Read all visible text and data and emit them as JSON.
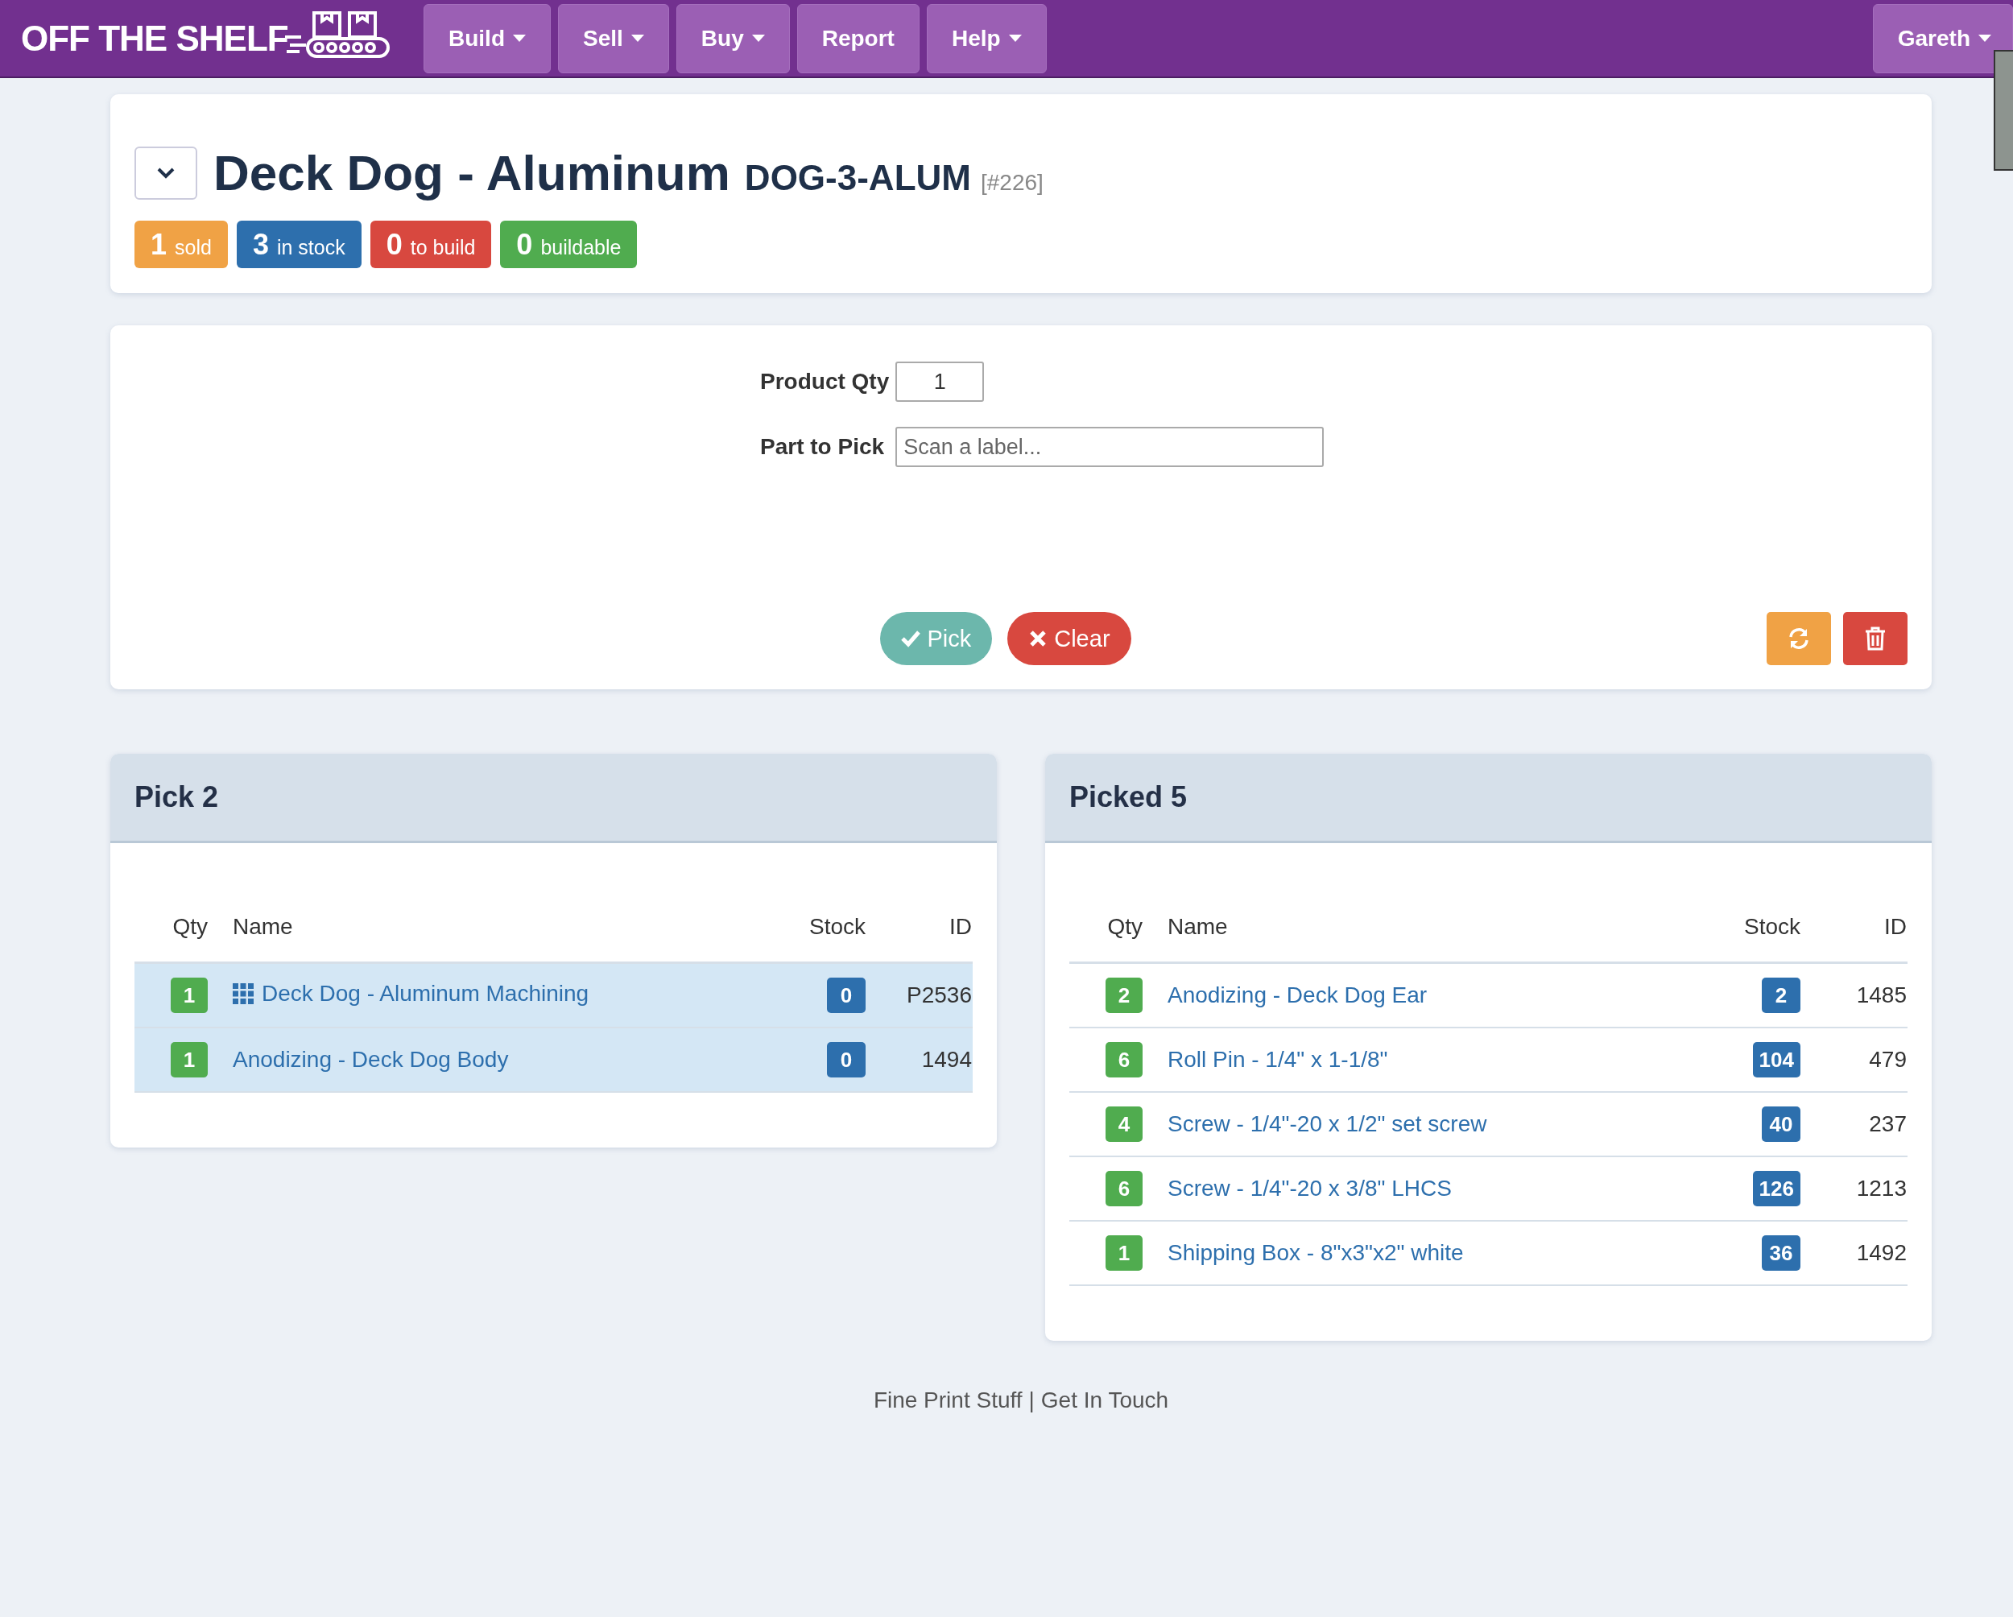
{
  "navbar": {
    "brand": "OFF THE SHELF",
    "menu": [
      {
        "label": "Build",
        "dropdown": true
      },
      {
        "label": "Sell",
        "dropdown": true
      },
      {
        "label": "Buy",
        "dropdown": true
      },
      {
        "label": "Report",
        "dropdown": false
      },
      {
        "label": "Help",
        "dropdown": true
      }
    ],
    "user": {
      "label": "Gareth",
      "dropdown": true
    }
  },
  "product": {
    "name": "Deck Dog - Aluminum",
    "sku": "DOG-3-ALUM",
    "number": "[#226]",
    "stats": [
      {
        "value": "1",
        "label": "sold",
        "color": "#f0a245"
      },
      {
        "value": "3",
        "label": "in stock",
        "color": "#2d6fad"
      },
      {
        "value": "0",
        "label": "to build",
        "color": "#d8483f"
      },
      {
        "value": "0",
        "label": "buildable",
        "color": "#50ac4f"
      }
    ]
  },
  "pick_form": {
    "fields": [
      {
        "label": "Product Qty",
        "value": "1",
        "kind": "qty"
      },
      {
        "label": "Part to Pick",
        "placeholder": "Scan a label...",
        "kind": "scan"
      }
    ],
    "buttons": [
      {
        "label": "Pick",
        "kind": "pick"
      },
      {
        "label": "Clear",
        "kind": "clear"
      }
    ],
    "tools": [
      {
        "kind": "refresh"
      },
      {
        "kind": "delete"
      }
    ]
  },
  "panels": [
    {
      "title": "Pick 2",
      "columns": [
        "Qty",
        "Name",
        "Stock",
        "ID"
      ],
      "rows": [
        {
          "qty": "1",
          "name": "Deck Dog - Aluminum Machining",
          "stock": "0",
          "id": "P2536",
          "kind": "assembly",
          "highlighted": true
        },
        {
          "qty": "1",
          "name": "Anodizing - Deck Dog Body",
          "stock": "0",
          "id": "1494",
          "kind": "part",
          "highlighted": true
        }
      ]
    },
    {
      "title": "Picked 5",
      "columns": [
        "Qty",
        "Name",
        "Stock",
        "ID"
      ],
      "rows": [
        {
          "qty": "2",
          "name": "Anodizing - Deck Dog Ear",
          "stock": "2",
          "id": "1485",
          "kind": "part",
          "highlighted": false
        },
        {
          "qty": "6",
          "name": "Roll Pin - 1/4\" x 1-1/8\"",
          "stock": "104",
          "id": "479",
          "kind": "part",
          "highlighted": false
        },
        {
          "qty": "4",
          "name": "Screw - 1/4\"-20 x 1/2\" set screw",
          "stock": "40",
          "id": "237",
          "kind": "part",
          "highlighted": false
        },
        {
          "qty": "6",
          "name": "Screw - 1/4\"-20 x 3/8\" LHCS",
          "stock": "126",
          "id": "1213",
          "kind": "part",
          "highlighted": false
        },
        {
          "qty": "1",
          "name": "Shipping Box - 8\"x3\"x2\" white",
          "stock": "36",
          "id": "1492",
          "kind": "part",
          "highlighted": false
        }
      ]
    }
  ],
  "footer": {
    "links": [
      "Fine Print Stuff",
      "Get In Touch"
    ],
    "separator": "|"
  }
}
